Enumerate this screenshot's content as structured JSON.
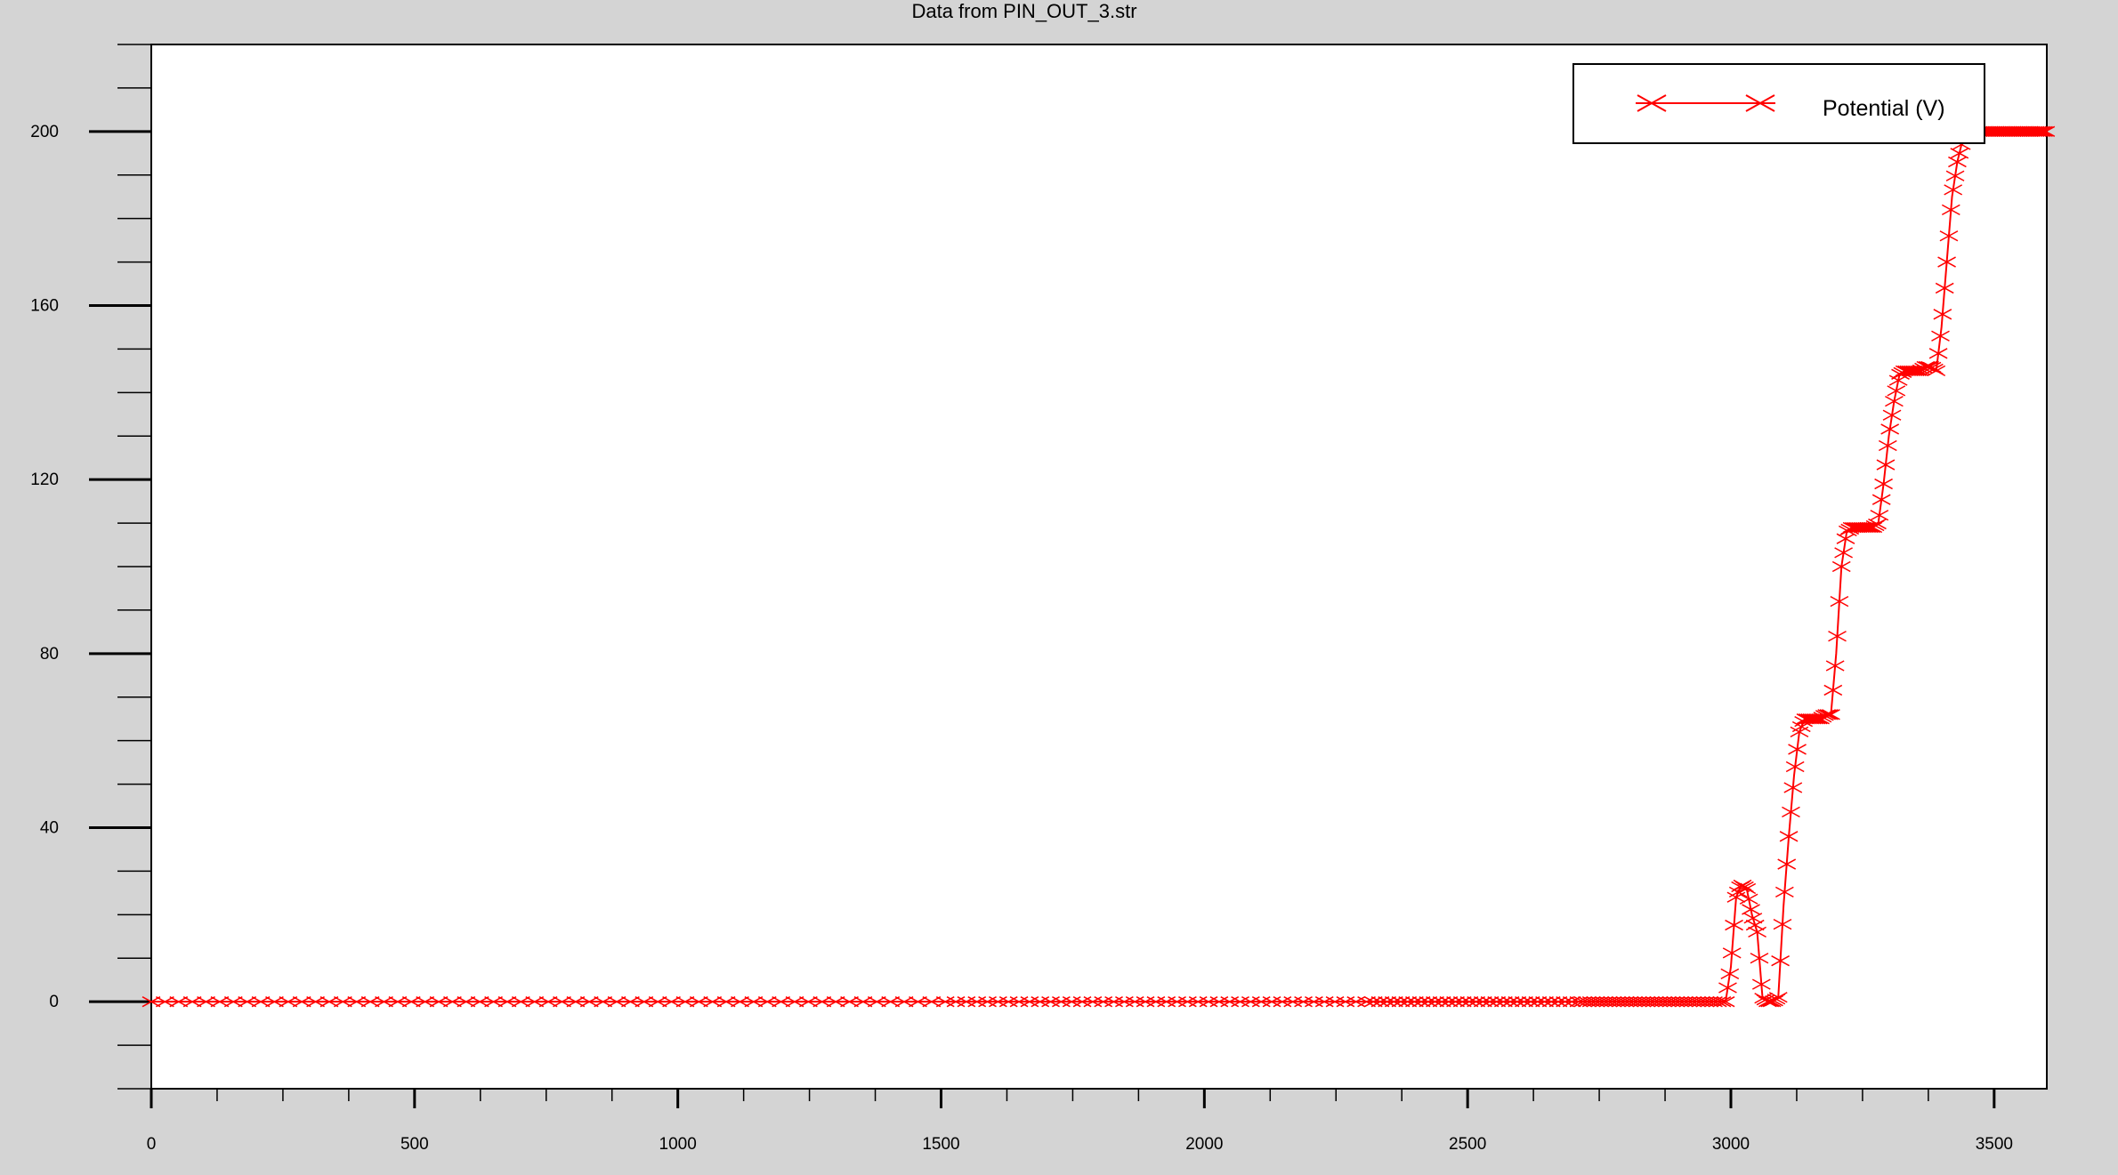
{
  "window": {
    "background": "#d4d4d4"
  },
  "chart_data": {
    "type": "line",
    "title": "Data from PIN_OUT_3.str",
    "xlabel": "",
    "ylabel": "",
    "xlim": [
      0,
      3600
    ],
    "ylim": [
      -20,
      220
    ],
    "x_ticks": [
      0,
      500,
      1000,
      1500,
      2000,
      2500,
      3000,
      3500
    ],
    "y_ticks": [
      0,
      40,
      80,
      120,
      160,
      200
    ],
    "grid": false,
    "legend": {
      "position": "top-right",
      "marker": "x-marker"
    },
    "series": [
      {
        "name": "Potential (V)",
        "color": "#ff0000",
        "marker": "x",
        "x": [
          0,
          500,
          1000,
          1500,
          2000,
          2500,
          2990,
          3000,
          3010,
          3020,
          3030,
          3040,
          3050,
          3060,
          3070,
          3080,
          3090,
          3100,
          3110,
          3120,
          3130,
          3140,
          3150,
          3160,
          3170,
          3180,
          3190,
          3200,
          3210,
          3220,
          3230,
          3240,
          3250,
          3260,
          3270,
          3280,
          3290,
          3300,
          3310,
          3320,
          3330,
          3340,
          3350,
          3360,
          3370,
          3380,
          3390,
          3400,
          3410,
          3420,
          3430,
          3440,
          3450,
          3460,
          3470,
          3480,
          3500,
          3540,
          3600
        ],
        "y": [
          0,
          0,
          0,
          0,
          0,
          0,
          0,
          8,
          24,
          27,
          26,
          20,
          16,
          1,
          0,
          0,
          1,
          22,
          38,
          52,
          62,
          65,
          65,
          65,
          65,
          66,
          66,
          80,
          100,
          108,
          109,
          109,
          109,
          109,
          109,
          110,
          119,
          130,
          138,
          144,
          145,
          145,
          145,
          145,
          146,
          146,
          145,
          155,
          170,
          185,
          193,
          198,
          200,
          200,
          200,
          200,
          200,
          200,
          200
        ]
      }
    ]
  }
}
